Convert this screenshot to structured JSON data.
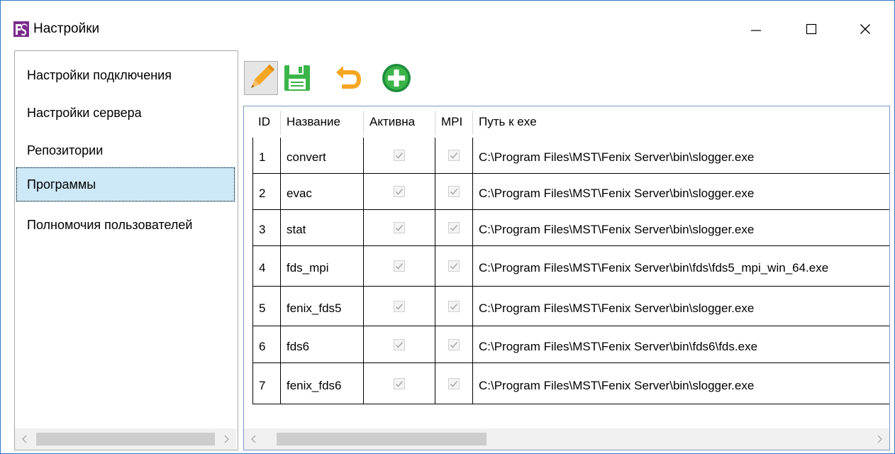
{
  "window": {
    "title": "Настройки",
    "logo_icon": "fenix-logo-icon",
    "controls": [
      "minimize-icon",
      "maximize-icon",
      "close-icon"
    ]
  },
  "sidebar": {
    "items": [
      {
        "label": "Настройки подключения",
        "selected": false
      },
      {
        "label": "Настройки сервера",
        "selected": false
      },
      {
        "label": "Репозитории",
        "selected": false
      },
      {
        "label": "Программы",
        "selected": true
      },
      {
        "label": "Полномочия пользователей",
        "selected": false
      }
    ]
  },
  "toolbar": {
    "buttons": [
      "pencil-edit-icon",
      "floppy-save-icon",
      "undo-arrow-icon",
      "add-plus-icon"
    ]
  },
  "table": {
    "columns": [
      "ID",
      "Название",
      "Активна",
      "MPI",
      "Путь к exe"
    ],
    "rows": [
      {
        "id": "1",
        "name": "convert",
        "active": true,
        "mpi": true,
        "path": "C:\\Program Files\\MST\\Fenix Server\\bin\\slogger.exe"
      },
      {
        "id": "2",
        "name": "evac",
        "active": true,
        "mpi": true,
        "path": "C:\\Program Files\\MST\\Fenix Server\\bin\\slogger.exe"
      },
      {
        "id": "3",
        "name": "stat",
        "active": true,
        "mpi": true,
        "path": "C:\\Program Files\\MST\\Fenix Server\\bin\\slogger.exe"
      },
      {
        "id": "4",
        "name": "fds_mpi",
        "active": true,
        "mpi": true,
        "path": "C:\\Program Files\\MST\\Fenix Server\\bin\\fds\\fds5_mpi_win_64.exe"
      },
      {
        "id": "5",
        "name": "fenix_fds5",
        "active": true,
        "mpi": true,
        "path": "C:\\Program Files\\MST\\Fenix Server\\bin\\slogger.exe"
      },
      {
        "id": "6",
        "name": "fds6",
        "active": true,
        "mpi": true,
        "path": "C:\\Program Files\\MST\\Fenix Server\\bin\\fds6\\fds.exe"
      },
      {
        "id": "7",
        "name": "fenix_fds6",
        "active": true,
        "mpi": true,
        "path": "C:\\Program Files\\MST\\Fenix Server\\bin\\slogger.exe"
      }
    ]
  },
  "colors": {
    "window_border": "#2b79c7",
    "selection": "#cde8f7",
    "grid_border": "#7a98c4"
  }
}
